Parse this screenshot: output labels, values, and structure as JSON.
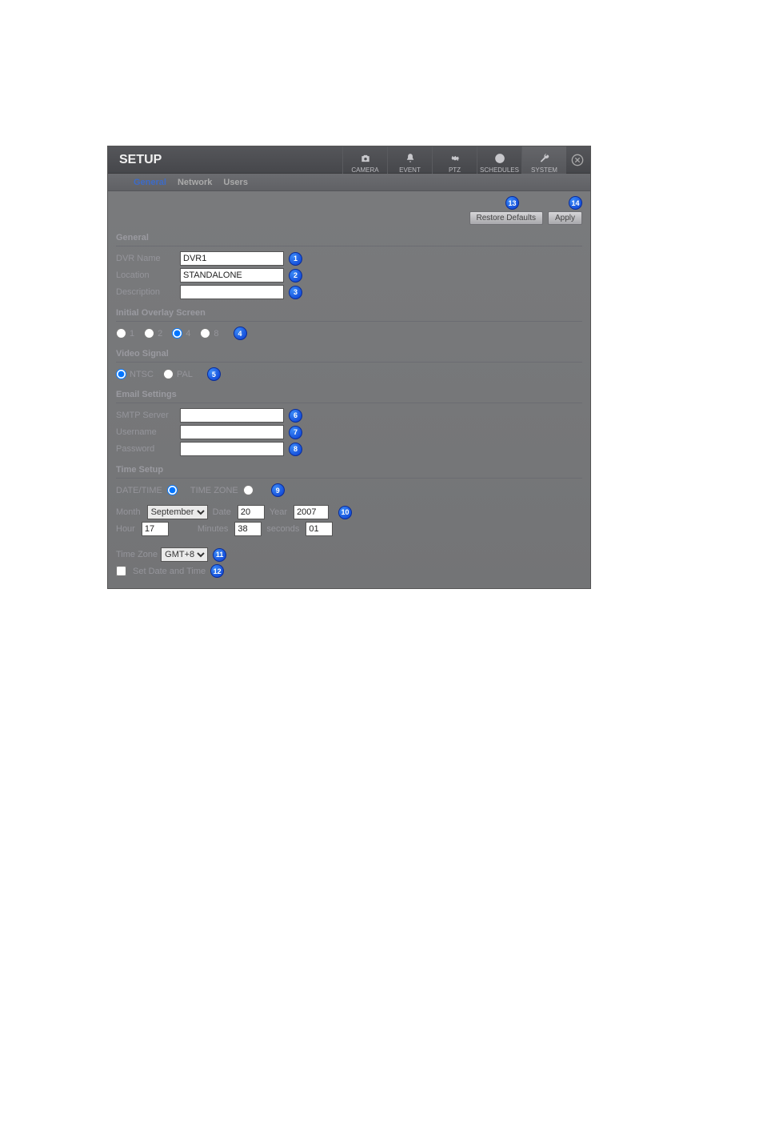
{
  "title": "SETUP",
  "topnav": {
    "camera": "CAMERA",
    "event": "EVENT",
    "ptz": "PTZ",
    "schedules": "SCHEDULES",
    "system": "SYSTEM"
  },
  "subtabs": {
    "general": "General",
    "network": "Network",
    "users": "Users"
  },
  "buttons": {
    "restore": "Restore Defaults",
    "apply": "Apply"
  },
  "sections": {
    "general": "General",
    "overlay": "Initial Overlay Screen",
    "video": "Video Signal",
    "email": "Email Settings",
    "time": "Time Setup"
  },
  "general": {
    "dvr_name_label": "DVR Name",
    "dvr_name_value": "DVR1",
    "location_label": "Location",
    "location_value": "STANDALONE",
    "description_label": "Description",
    "description_value": ""
  },
  "overlay": {
    "opt1": "1",
    "opt2": "2",
    "opt4": "4",
    "opt8": "8"
  },
  "video": {
    "ntsc": "NTSC",
    "pal": "PAL"
  },
  "email": {
    "smtp_label": "SMTP Server",
    "smtp_value": "",
    "user_label": "Username",
    "user_value": "",
    "pass_label": "Password",
    "pass_value": ""
  },
  "time": {
    "mode_datetime": "DATE/TIME",
    "mode_timezone": "TIME ZONE",
    "month_label": "Month",
    "month_value": "September",
    "date_label": "Date",
    "date_value": "20",
    "year_label": "Year",
    "year_value": "2007",
    "hour_label": "Hour",
    "hour_value": "17",
    "minutes_label": "Minutes",
    "minutes_value": "38",
    "seconds_label": "seconds",
    "seconds_value": "01",
    "tz_label": "Time Zone",
    "tz_value": "GMT+8",
    "set_label": "Set Date and Time"
  },
  "markers": {
    "m1": "1",
    "m2": "2",
    "m3": "3",
    "m4": "4",
    "m5": "5",
    "m6": "6",
    "m7": "7",
    "m8": "8",
    "m9": "9",
    "m10": "10",
    "m11": "11",
    "m12": "12",
    "m13": "13",
    "m14": "14"
  }
}
